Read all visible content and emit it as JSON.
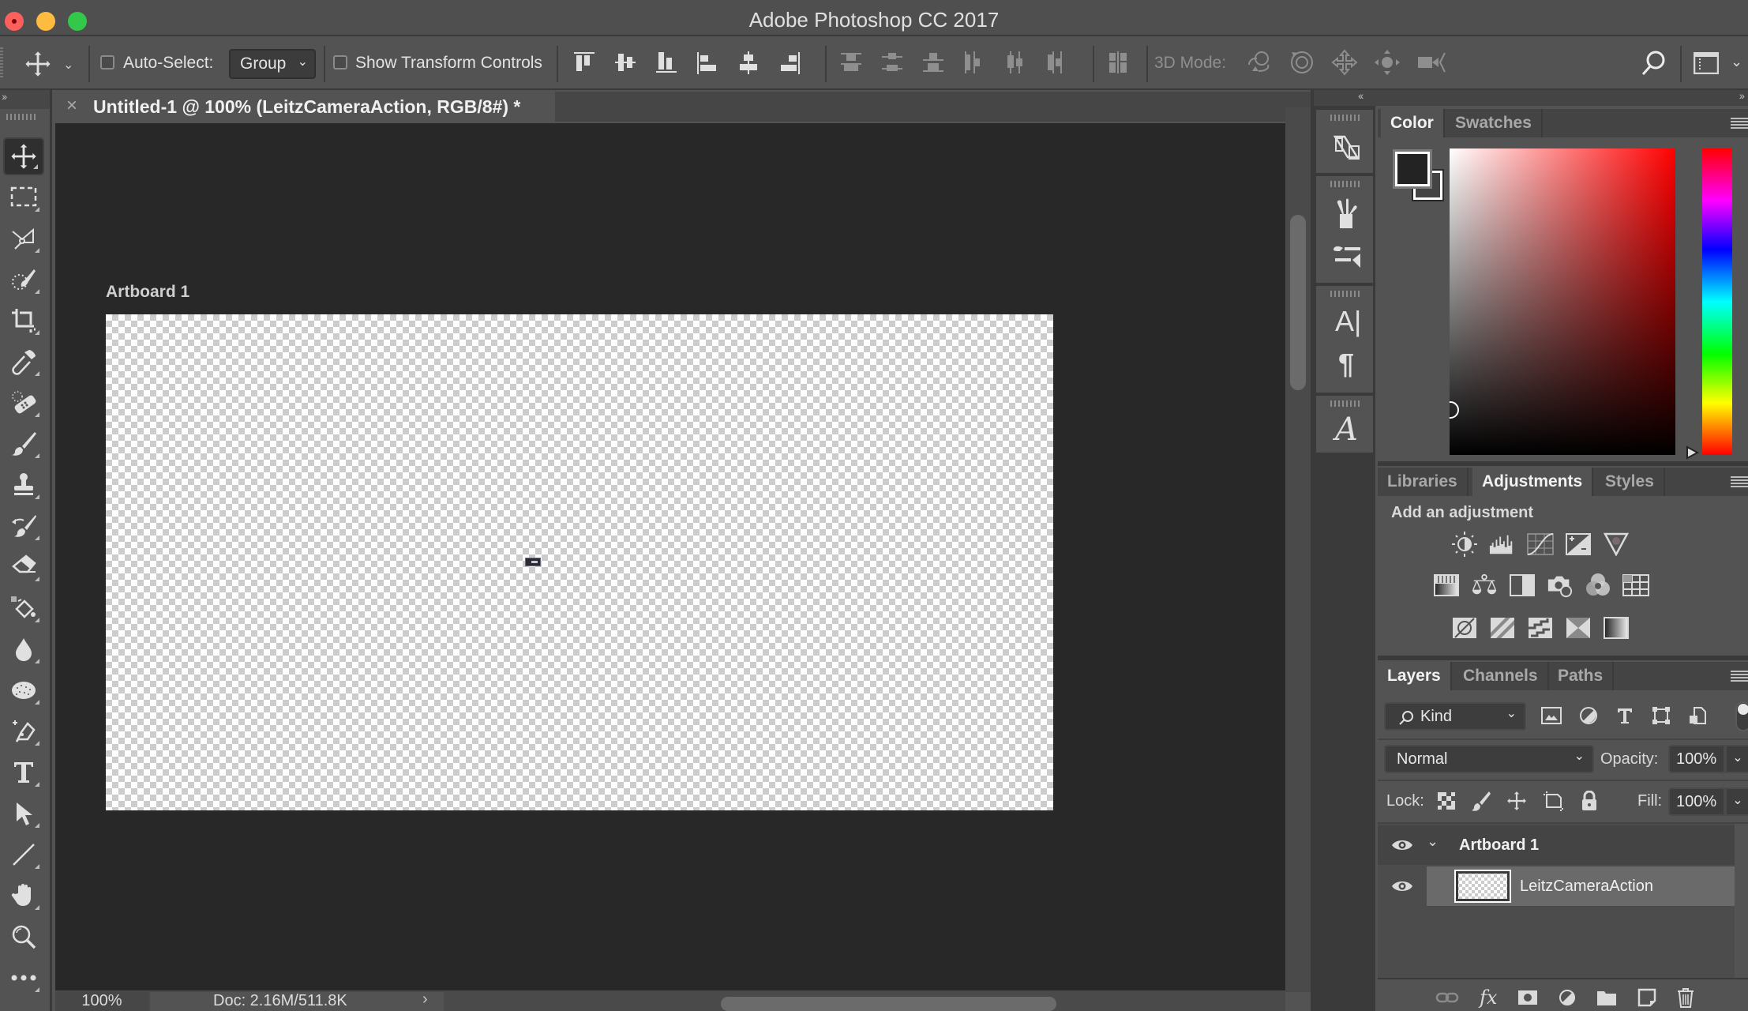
{
  "window": {
    "title": "Adobe Photoshop CC 2017",
    "traffic_lights": [
      {
        "name": "close",
        "color": "#fc605c"
      },
      {
        "name": "minimize",
        "color": "#fdbc40"
      },
      {
        "name": "maximize",
        "color": "#34c84a"
      }
    ]
  },
  "options_bar": {
    "tool_icon": "move-icon",
    "auto_select_label": "Auto-Select:",
    "auto_select_checked": false,
    "auto_select_mode": "Group",
    "show_transform_label": "Show Transform Controls",
    "show_transform_checked": false,
    "align_icons": [
      "align-top-edges-icon",
      "align-vertical-centers-icon",
      "align-bottom-edges-icon",
      "align-left-edges-icon",
      "align-horizontal-centers-icon",
      "align-right-edges-icon"
    ],
    "distribute_icons": [
      "distribute-top-icon",
      "distribute-vertical-centers-icon",
      "distribute-bottom-icon",
      "distribute-left-icon",
      "distribute-horizontal-centers-icon",
      "distribute-right-icon"
    ],
    "auto_align_icon": "auto-align-layers-icon",
    "mode_3d_label": "3D Mode:",
    "mode_3d_icons": [
      "orbit-3d-icon",
      "roll-3d-icon",
      "drag-3d-icon",
      "slide-3d-icon",
      "scale-3d-icon"
    ],
    "search_icon": "search-icon",
    "workspace_icon": "workspace-icon"
  },
  "tools": [
    {
      "name": "move-tool",
      "active": true
    },
    {
      "name": "rectangular-marquee-tool"
    },
    {
      "name": "polygonal-lasso-tool"
    },
    {
      "name": "quick-selection-tool"
    },
    {
      "name": "crop-tool"
    },
    {
      "name": "eyedropper-tool"
    },
    {
      "name": "spot-healing-brush-tool"
    },
    {
      "name": "brush-tool"
    },
    {
      "name": "clone-stamp-tool"
    },
    {
      "name": "history-brush-tool"
    },
    {
      "name": "eraser-tool"
    },
    {
      "name": "paint-bucket-tool"
    },
    {
      "name": "blur-tool"
    },
    {
      "name": "sponge-tool"
    },
    {
      "name": "pen-tool"
    },
    {
      "name": "type-tool"
    },
    {
      "name": "path-selection-tool"
    },
    {
      "name": "line-tool"
    },
    {
      "name": "hand-tool"
    },
    {
      "name": "zoom-tool"
    },
    {
      "name": "edit-toolbar"
    }
  ],
  "document": {
    "tab_title": "Untitled-1 @ 100% (LeitzCameraAction, RGB/8#) *",
    "close_glyph": "×",
    "artboard_label": "Artboard 1",
    "zoom": "100%",
    "doc_info": "Doc: 2.16M/511.8K",
    "doc_info_arrow": "›"
  },
  "collapsed_panels": [
    {
      "icons": [
        "history-panel-icon"
      ]
    },
    {
      "icons": [
        "brushes-panel-icon",
        "brush-settings-panel-icon"
      ]
    },
    {
      "icons": [
        "character-panel-icon",
        "paragraph-panel-icon"
      ]
    },
    {
      "icons": [
        "glyphs-panel-icon"
      ]
    }
  ],
  "color_panel": {
    "tabs": [
      {
        "label": "Color",
        "active": true
      },
      {
        "label": "Swatches",
        "active": false
      }
    ],
    "foreground_color": "#232323",
    "background_color": "#444444",
    "hue": "#ff0000"
  },
  "adjustments_panel": {
    "tabs": [
      {
        "label": "Libraries",
        "active": false
      },
      {
        "label": "Adjustments",
        "active": true
      },
      {
        "label": "Styles",
        "active": false
      }
    ],
    "heading": "Add an adjustment",
    "rows": [
      [
        "brightness-contrast-icon",
        "levels-icon",
        "curves-icon",
        "exposure-icon",
        "vibrance-icon"
      ],
      [
        "hue-saturation-icon",
        "color-balance-icon",
        "black-white-icon",
        "photo-filter-icon",
        "channel-mixer-icon",
        "color-lookup-icon"
      ],
      [
        "invert-icon",
        "posterize-icon",
        "threshold-icon",
        "selective-color-icon",
        "gradient-map-icon"
      ]
    ]
  },
  "layers_panel": {
    "tabs": [
      {
        "label": "Layers",
        "active": true
      },
      {
        "label": "Channels",
        "active": false
      },
      {
        "label": "Paths",
        "active": false
      }
    ],
    "filter_kind": "Kind",
    "filter_icons": [
      "pixel-filter-icon",
      "adjustment-filter-icon",
      "type-filter-icon",
      "shape-filter-icon",
      "smart-object-filter-icon"
    ],
    "blend_mode": "Normal",
    "opacity_label": "Opacity:",
    "opacity": "100%",
    "lock_label": "Lock:",
    "lock_icons": [
      "lock-transparent-icon",
      "lock-image-icon",
      "lock-position-icon",
      "lock-artboard-icon",
      "lock-all-icon"
    ],
    "fill_label": "Fill:",
    "fill": "100%",
    "layers": [
      {
        "name": "Artboard 1",
        "type": "artboard",
        "visible": true,
        "expanded": true,
        "selected": false
      },
      {
        "name": "LeitzCameraAction",
        "type": "pixel",
        "visible": true,
        "selected": true
      }
    ],
    "footer_icons": [
      "link-layers-icon",
      "layer-style-icon",
      "add-mask-icon",
      "new-adjustment-layer-icon",
      "new-group-icon",
      "new-layer-icon",
      "delete-layer-icon"
    ]
  }
}
